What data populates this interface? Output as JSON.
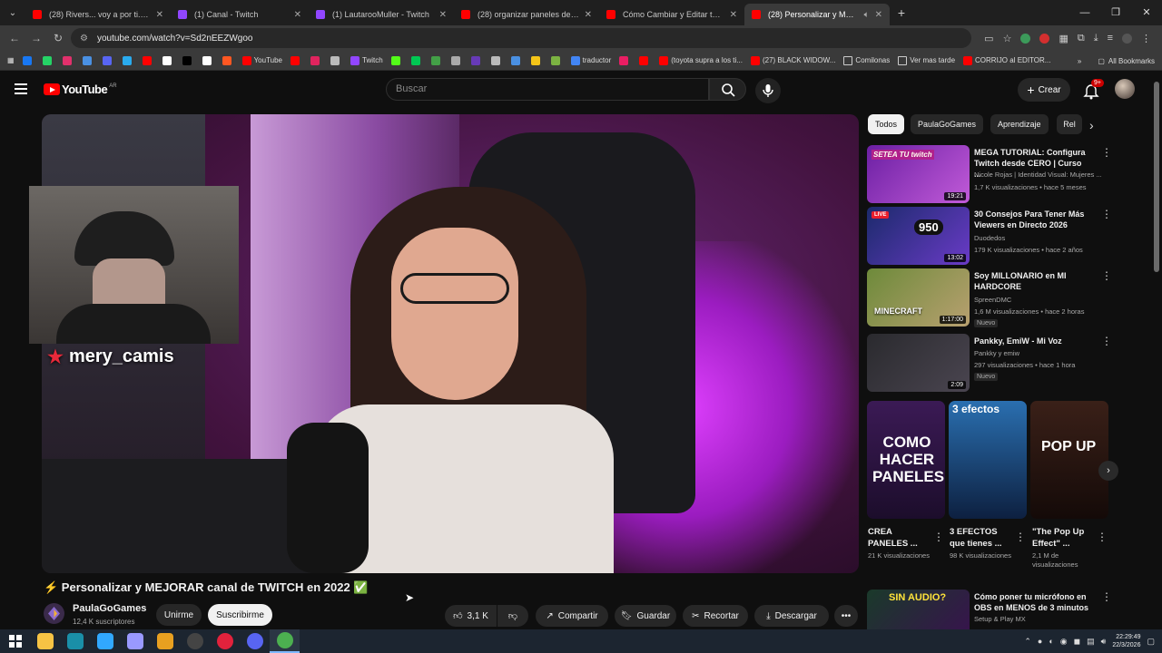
{
  "browser": {
    "tabs": [
      {
        "title": "(28) Rivers... voy a por ti. - YouT",
        "color": "#ff0000",
        "active": false
      },
      {
        "title": "(1) Canal - Twitch",
        "color": "#9146ff",
        "active": false
      },
      {
        "title": "(1) LautarooMuller - Twitch",
        "color": "#9146ff",
        "active": false
      },
      {
        "title": "(28) organizar paneles de twitch",
        "color": "#ff0000",
        "active": false
      },
      {
        "title": "Cómo Cambiar y Editar tus PA",
        "color": "#ff0000",
        "active": false
      },
      {
        "title": "(28) Personalizar y MEJO",
        "color": "#ff0000",
        "active": true
      }
    ],
    "url": "youtube.com/watch?v=Sd2nEEZWgoo",
    "bookmarks": [
      {
        "label": "",
        "color": "#1877f2"
      },
      {
        "label": "",
        "color": "#25d366"
      },
      {
        "label": "",
        "color": "#e1306c"
      },
      {
        "label": "",
        "color": "#4a90e2"
      },
      {
        "label": "",
        "color": "#5865f2"
      },
      {
        "label": "",
        "color": "#2aabee"
      },
      {
        "label": "",
        "color": "#ff0000"
      },
      {
        "label": "",
        "color": "#ffffff"
      },
      {
        "label": "",
        "color": "#000000"
      },
      {
        "label": "",
        "color": "#ffffff"
      },
      {
        "label": "",
        "color": "#ff5722"
      },
      {
        "label": "YouTube",
        "color": "#ff0000"
      },
      {
        "label": "",
        "color": "#ff0000"
      },
      {
        "label": "",
        "color": "#e0245e"
      },
      {
        "label": "",
        "color": "#bbbbbb"
      },
      {
        "label": "Twitch",
        "color": "#9146ff"
      },
      {
        "label": "",
        "color": "#53fc18"
      },
      {
        "label": "",
        "color": "#00c853"
      },
      {
        "label": "",
        "color": "#43a047"
      },
      {
        "label": "",
        "color": "#aaaaaa"
      },
      {
        "label": "",
        "color": "#673ab7"
      },
      {
        "label": "",
        "color": "#bbbbbb"
      },
      {
        "label": "",
        "color": "#4a90e2"
      },
      {
        "label": "",
        "color": "#f5c518"
      },
      {
        "label": "",
        "color": "#7cb342"
      },
      {
        "label": "traductor",
        "color": "#4285f4"
      },
      {
        "label": "",
        "color": "#e91e63"
      },
      {
        "label": "",
        "color": "#ff0000"
      },
      {
        "label": "(toyota supra a los ti...",
        "color": "#ff0000"
      },
      {
        "label": "(27) BLACK WIDOW...",
        "color": "#ff0000"
      },
      {
        "label": "Comilonas",
        "color": "folder"
      },
      {
        "label": "Ver mas tarde",
        "color": "folder"
      },
      {
        "label": "CORRIJO al EDITOR...",
        "color": "#ff0000"
      }
    ],
    "all_bookmarks": "All Bookmarks"
  },
  "header": {
    "logo_text": "YouTube",
    "country": "AR",
    "search_placeholder": "Buscar",
    "create_label": "Crear",
    "notif_badge": "9+"
  },
  "player": {
    "streamer_name": "mery_camis"
  },
  "video": {
    "title": "⚡ Personalizar y MEJORAR canal de TWITCH en 2022 ✅",
    "channel": "PaulaGoGames",
    "subscribers": "12,4 K suscriptores",
    "join_label": "Unirme",
    "subscribe_label": "Suscribirme",
    "likes": "3,1 K",
    "share_label": "Compartir",
    "save_label": "Guardar",
    "clip_label": "Recortar",
    "download_label": "Descargar"
  },
  "sidebar": {
    "chips": [
      "Todos",
      "PaulaGoGames",
      "Aprendizaje",
      "Rel"
    ],
    "recommendations": [
      {
        "title": "MEGA TUTORIAL: Configura Twitch desde CERO | Curso ...",
        "channel": "Nicole Rojas | Identidad Visual: Mujeres ...",
        "meta": "1,7 K visualizaciones • hace 5 meses",
        "duration": "19:21",
        "thumb_text": "SETEA TU twitch",
        "is_new": false
      },
      {
        "title": "30 Consejos Para Tener Más Viewers en Directo 2026",
        "channel": "Duodedos",
        "meta": "179 K visualizaciones • hace 2 años",
        "duration": "13:02",
        "thumb_text": "950",
        "is_new": false
      },
      {
        "title": "Soy MILLONARIO en MI HARDCORE",
        "channel": "SpreenDMC",
        "meta": "1,6 M visualizaciones • hace 2 horas",
        "duration": "1:17:00",
        "thumb_text": "MINECRAFT",
        "is_new": true
      },
      {
        "title": "Pankky, EmiW - Mi Voz",
        "channel": "Pankky y emiw",
        "meta": "297 visualizaciones • hace 1 hora",
        "duration": "2:09",
        "thumb_text": "",
        "is_new": true
      }
    ],
    "new_label": "Nuevo",
    "shorts": [
      {
        "title": "CREA PANELES ...",
        "views": "21 K visualizaciones",
        "thumb_text": "COMO HACER PANELES"
      },
      {
        "title": "3 EFECTOS que tienes ...",
        "views": "98 K visualizaciones",
        "thumb_text": "3 efectos"
      },
      {
        "title": "\"The Pop Up Effect\" ...",
        "views": "2,1 M de visualizaciones",
        "thumb_text": "POP UP"
      }
    ],
    "last": {
      "title": "Cómo poner tu micrófono en OBS en MENOS de 3 minutos",
      "channel": "Setup & Play MX",
      "thumb_text": "SIN AUDIO?"
    }
  },
  "taskbar": {
    "apps": [
      {
        "name": "file-explorer",
        "color": "#f6c344"
      },
      {
        "name": "app-teal",
        "color": "#1a8fa8"
      },
      {
        "name": "photoshop",
        "color": "#31a8ff"
      },
      {
        "name": "premiere",
        "color": "#9999ff"
      },
      {
        "name": "app-orange",
        "color": "#e8a020"
      },
      {
        "name": "obs",
        "color": "#444444"
      },
      {
        "name": "app-red",
        "color": "#e2223c"
      },
      {
        "name": "discord",
        "color": "#5865f2"
      },
      {
        "name": "chrome",
        "color": "#4caf50"
      }
    ],
    "time": "22:29:49",
    "date": "22/3/2026"
  }
}
